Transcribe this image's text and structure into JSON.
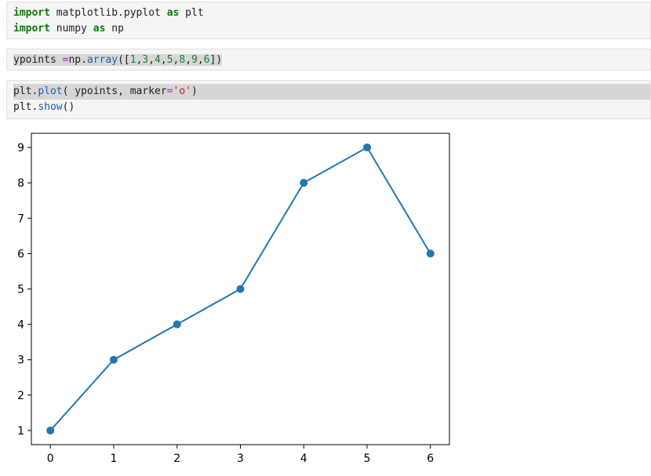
{
  "cells": [
    {
      "lines": [
        [
          {
            "t": "import",
            "c": "kw"
          },
          {
            "t": " matplotlib.pyplot ",
            "c": ""
          },
          {
            "t": "as",
            "c": "kw"
          },
          {
            "t": " plt",
            "c": ""
          }
        ],
        [
          {
            "t": "import",
            "c": "kw"
          },
          {
            "t": " numpy ",
            "c": ""
          },
          {
            "t": "as",
            "c": "kw"
          },
          {
            "t": " np",
            "c": ""
          }
        ]
      ]
    },
    {
      "lines": [
        [
          {
            "t": "ypoints ",
            "c": ""
          },
          {
            "t": "=",
            "c": "op"
          },
          {
            "t": "np.",
            "c": ""
          },
          {
            "t": "array",
            "c": "fn"
          },
          {
            "t": "([",
            "c": "br"
          },
          {
            "t": "1",
            "c": "num"
          },
          {
            "t": ",",
            "c": ""
          },
          {
            "t": "3",
            "c": "num"
          },
          {
            "t": ",",
            "c": ""
          },
          {
            "t": "4",
            "c": "num"
          },
          {
            "t": ",",
            "c": ""
          },
          {
            "t": "5",
            "c": "num"
          },
          {
            "t": ",",
            "c": ""
          },
          {
            "t": "8",
            "c": "num"
          },
          {
            "t": ",",
            "c": ""
          },
          {
            "t": "9",
            "c": "num"
          },
          {
            "t": ",",
            "c": ""
          },
          {
            "t": "6",
            "c": "num"
          },
          {
            "t": "])",
            "c": "br"
          }
        ]
      ]
    },
    {
      "lines": [
        [
          {
            "t": "plt.",
            "c": ""
          },
          {
            "t": "plot",
            "c": "fn"
          },
          {
            "t": "( ypoints, marker",
            "c": ""
          },
          {
            "t": "=",
            "c": "op"
          },
          {
            "t": "'o'",
            "c": "str"
          },
          {
            "t": ")",
            "c": ""
          }
        ],
        [
          {
            "t": "plt.",
            "c": ""
          },
          {
            "t": "show",
            "c": "fn"
          },
          {
            "t": "()",
            "c": ""
          }
        ]
      ]
    }
  ],
  "chart_data": {
    "type": "line",
    "x": [
      0,
      1,
      2,
      3,
      4,
      5,
      6
    ],
    "series": [
      {
        "values": [
          1,
          3,
          4,
          5,
          8,
          9,
          6
        ],
        "color": "#1f77b4",
        "marker": "o"
      }
    ],
    "xticks": [
      "0",
      "1",
      "2",
      "3",
      "4",
      "5",
      "6"
    ],
    "yticks": [
      "1",
      "2",
      "3",
      "4",
      "5",
      "6",
      "7",
      "8",
      "9"
    ],
    "xlim": [
      -0.3,
      6.3
    ],
    "ylim": [
      0.6,
      9.4
    ],
    "grid": false
  }
}
